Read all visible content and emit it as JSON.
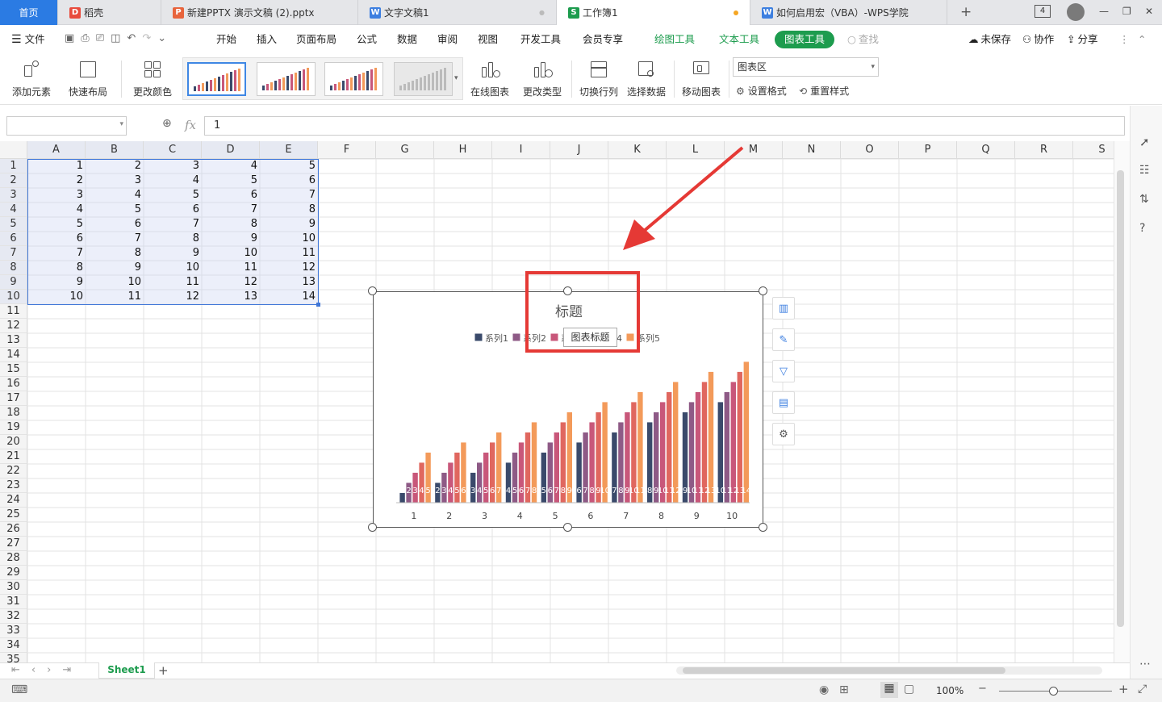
{
  "tabs": [
    {
      "label": "首页",
      "kind": "home"
    },
    {
      "label": "稻壳",
      "icon": "daoke-icon",
      "icon_color": "#e84b3c",
      "icon_glyph": "D"
    },
    {
      "label": "新建PPTX 演示文稿 (2).pptx",
      "icon": "pptx-icon",
      "icon_color": "#e8643c",
      "icon_glyph": "P"
    },
    {
      "label": "文字文稿1",
      "icon": "doc-icon",
      "icon_color": "#3d7fe0",
      "icon_glyph": "W"
    },
    {
      "label": "工作簿1",
      "icon": "sheet-icon",
      "icon_color": "#1d9c4e",
      "icon_glyph": "S",
      "active": true
    },
    {
      "label": "如何启用宏（VBA）-WPS学院",
      "icon": "wps-icon",
      "icon_color": "#3d7fe0",
      "icon_glyph": "W"
    }
  ],
  "titlebar": {
    "add_tab": "+",
    "window_count": "4"
  },
  "menu": {
    "file": "文件",
    "items": [
      "开始",
      "插入",
      "页面布局",
      "公式",
      "数据",
      "审阅",
      "视图",
      "开发工具",
      "会员专享"
    ],
    "context": [
      "绘图工具",
      "文本工具",
      "图表工具"
    ],
    "search": "查找",
    "unsaved": "未保存",
    "collab": "协作",
    "share": "分享"
  },
  "ribbon": {
    "add_element": "添加元素",
    "quick_layout": "快速布局",
    "change_color": "更改颜色",
    "online_chart": "在线图表",
    "change_type": "更改类型",
    "switch_rowcol": "切换行列",
    "select_data": "选择数据",
    "move_chart": "移动图表",
    "area_select": "图表区",
    "set_format": "设置格式",
    "reset_style": "重置样式"
  },
  "formula": {
    "fx": "fx",
    "value": "1"
  },
  "columns": [
    "A",
    "B",
    "C",
    "D",
    "E",
    "F",
    "G",
    "H",
    "I",
    "J",
    "K",
    "L",
    "M",
    "N",
    "O",
    "P",
    "Q",
    "R",
    "S"
  ],
  "rows": [
    "1",
    "2",
    "3",
    "4",
    "5",
    "6",
    "7",
    "8",
    "9",
    "10",
    "11",
    "12",
    "13",
    "14",
    "15",
    "16",
    "17",
    "18",
    "19",
    "20",
    "21",
    "22",
    "23",
    "24",
    "25",
    "26",
    "27",
    "28",
    "29",
    "30",
    "31",
    "32",
    "33",
    "34",
    "35"
  ],
  "cells": [
    [
      "1",
      "2",
      "3",
      "4",
      "5"
    ],
    [
      "2",
      "3",
      "4",
      "5",
      "6"
    ],
    [
      "3",
      "4",
      "5",
      "6",
      "7"
    ],
    [
      "4",
      "5",
      "6",
      "7",
      "8"
    ],
    [
      "5",
      "6",
      "7",
      "8",
      "9"
    ],
    [
      "6",
      "7",
      "8",
      "9",
      "10"
    ],
    [
      "7",
      "8",
      "9",
      "10",
      "11"
    ],
    [
      "8",
      "9",
      "10",
      "11",
      "12"
    ],
    [
      "9",
      "10",
      "11",
      "12",
      "13"
    ],
    [
      "10",
      "11",
      "12",
      "13",
      "14"
    ]
  ],
  "chart_data": {
    "type": "bar",
    "title": "标题",
    "categories": [
      "1",
      "2",
      "3",
      "4",
      "5",
      "6",
      "7",
      "8",
      "9",
      "10"
    ],
    "series": [
      {
        "name": "系列1",
        "color": "#3a4a6b",
        "values": [
          1,
          2,
          3,
          4,
          5,
          6,
          7,
          8,
          9,
          10
        ]
      },
      {
        "name": "系列2",
        "color": "#8e5a86",
        "values": [
          2,
          3,
          4,
          5,
          6,
          7,
          8,
          9,
          10,
          11
        ]
      },
      {
        "name": "系列3",
        "color": "#c8577a",
        "values": [
          3,
          4,
          5,
          6,
          7,
          8,
          9,
          10,
          11,
          12
        ]
      },
      {
        "name": "系列4",
        "color": "#e0675f",
        "values": [
          4,
          5,
          6,
          7,
          8,
          9,
          10,
          11,
          12,
          13
        ]
      },
      {
        "name": "系列5",
        "color": "#f39a5a",
        "values": [
          5,
          6,
          7,
          8,
          9,
          10,
          11,
          12,
          13,
          14
        ]
      }
    ],
    "ylim": [
      0,
      14
    ],
    "data_labels": true,
    "legend": "top",
    "grid": false
  },
  "chart_tooltip": "图表标题",
  "sheet": {
    "name": "Sheet1",
    "add": "+"
  },
  "status": {
    "zoom": "100%"
  },
  "colors": {
    "accent": "#1d9c4e",
    "home": "#2b7be3",
    "annotation": "#e53935"
  }
}
